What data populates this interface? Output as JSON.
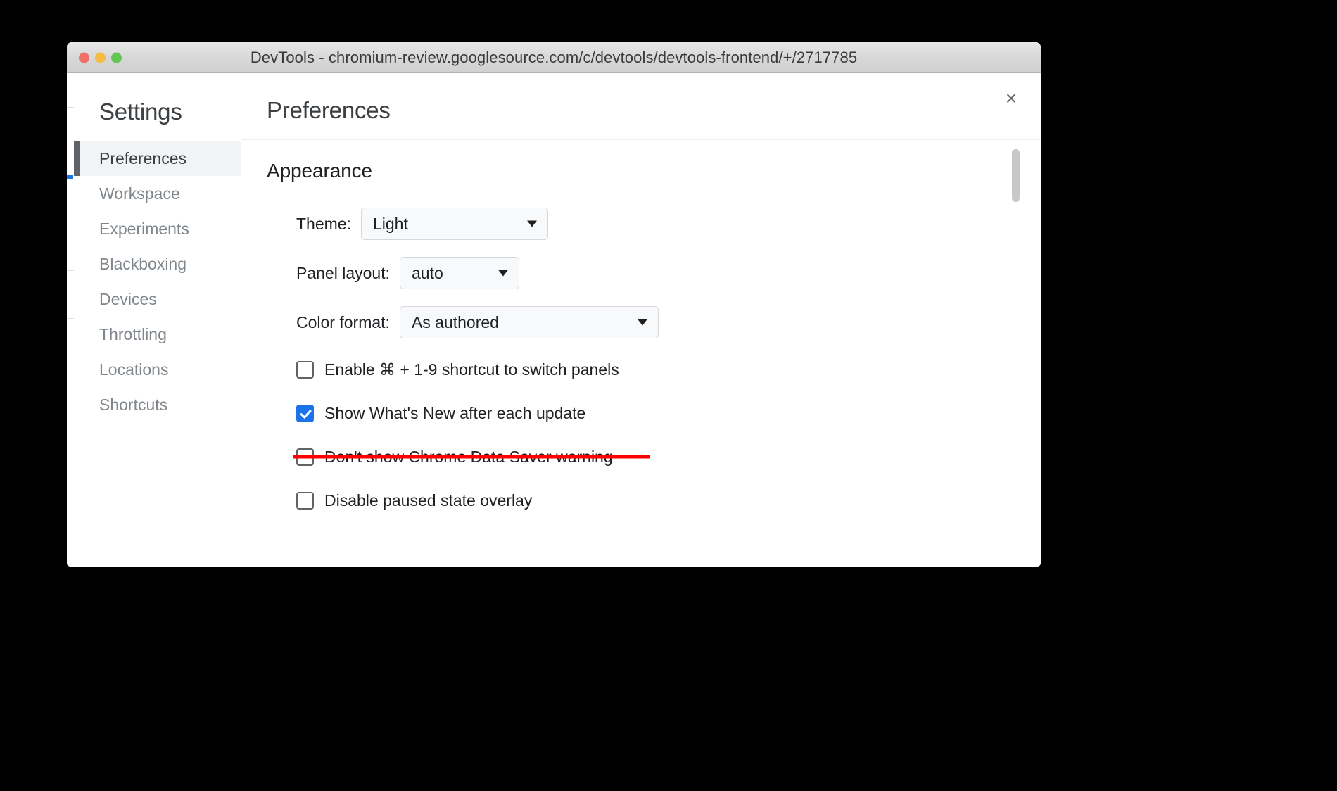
{
  "window": {
    "title": "DevTools - chromium-review.googlesource.com/c/devtools/devtools-frontend/+/2717785",
    "traffic_lights": {
      "close": "close-window",
      "minimize": "minimize-window",
      "maximize": "maximize-window"
    }
  },
  "settings": {
    "heading": "Settings",
    "close_label": "×",
    "nav_items": [
      {
        "label": "Preferences",
        "selected": true
      },
      {
        "label": "Workspace",
        "selected": false
      },
      {
        "label": "Experiments",
        "selected": false
      },
      {
        "label": "Blackboxing",
        "selected": false
      },
      {
        "label": "Devices",
        "selected": false
      },
      {
        "label": "Throttling",
        "selected": false
      },
      {
        "label": "Locations",
        "selected": false
      },
      {
        "label": "Shortcuts",
        "selected": false
      }
    ]
  },
  "main": {
    "title": "Preferences",
    "sections": [
      {
        "title": "Appearance",
        "fields": [
          {
            "label": "Theme:",
            "value": "Light",
            "name": "theme"
          },
          {
            "label": "Panel layout:",
            "value": "auto",
            "name": "panel-layout"
          },
          {
            "label": "Color format:",
            "value": "As authored",
            "name": "color-format"
          }
        ],
        "checkboxes": [
          {
            "label": "Enable ⌘ + 1-9 shortcut to switch panels",
            "checked": false,
            "struck": false,
            "name": "enable-cmd-shortcut"
          },
          {
            "label": "Show What's New after each update",
            "checked": true,
            "struck": false,
            "name": "show-whats-new"
          },
          {
            "label": "Don't show Chrome Data Saver warning",
            "checked": false,
            "struck": true,
            "name": "hide-data-saver-warning"
          },
          {
            "label": "Disable paused state overlay",
            "checked": false,
            "struck": false,
            "name": "disable-paused-overlay"
          }
        ]
      }
    ]
  },
  "colors": {
    "accent_blue": "#1a73e8",
    "strike_red": "#fe0000",
    "selected_bg": "#f1f3f4",
    "selected_bar": "#5f6368",
    "text_primary": "#202124",
    "text_muted": "#80868b"
  }
}
